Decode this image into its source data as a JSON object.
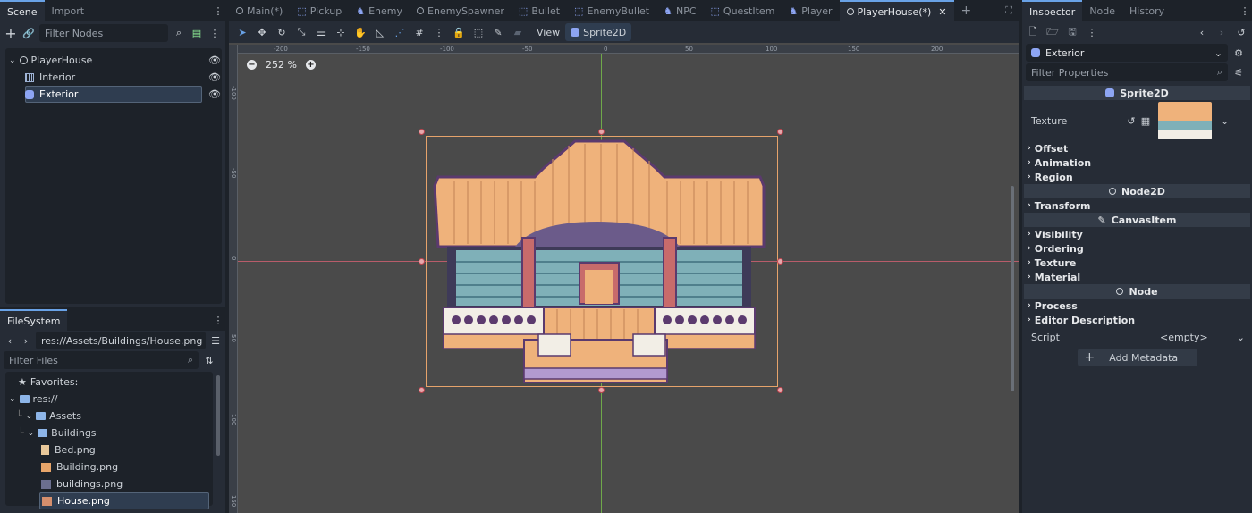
{
  "scene_panel": {
    "tabs": [
      "Scene",
      "Import"
    ],
    "filter_placeholder": "Filter Nodes",
    "nodes": [
      {
        "label": "PlayerHouse"
      },
      {
        "label": "Interior"
      },
      {
        "label": "Exterior"
      }
    ]
  },
  "filesystem": {
    "tab": "FileSystem",
    "path": "res://Assets/Buildings/House.png",
    "filter_placeholder": "Filter Files",
    "items": [
      {
        "label": "Favorites:"
      },
      {
        "label": "res://"
      },
      {
        "label": "Assets"
      },
      {
        "label": "Buildings"
      },
      {
        "label": "Bed.png"
      },
      {
        "label": "Building.png"
      },
      {
        "label": "buildings.png"
      },
      {
        "label": "House.png"
      }
    ]
  },
  "scene_tabs": [
    "Main(*)",
    "Pickup",
    "Enemy",
    "EnemySpawner",
    "Bullet",
    "EnemyBullet",
    "NPC",
    "QuestItem",
    "Player",
    "PlayerHouse(*)"
  ],
  "toolbar": {
    "view_label": "View",
    "sprite_label": "Sprite2D"
  },
  "viewport": {
    "zoom": "252 %",
    "ruler_h": [
      "-200",
      "-150",
      "-100",
      "-50",
      "0",
      "50",
      "100",
      "150",
      "200"
    ],
    "ruler_v": [
      "-100",
      "-50",
      "0",
      "50",
      "100",
      "150"
    ]
  },
  "inspector": {
    "tabs": [
      "Inspector",
      "Node",
      "History"
    ],
    "object": "Exterior",
    "filter_placeholder": "Filter Properties",
    "class_sprite": "Sprite2D",
    "texture_label": "Texture",
    "sprite_sections": [
      "Offset",
      "Animation",
      "Region"
    ],
    "class_node2d": "Node2D",
    "node2d_sections": [
      "Transform"
    ],
    "class_canvas": "CanvasItem",
    "canvas_sections": [
      "Visibility",
      "Ordering",
      "Texture",
      "Material"
    ],
    "class_node": "Node",
    "node_sections": [
      "Process",
      "Editor Description"
    ],
    "script_label": "Script",
    "script_value": "<empty>",
    "add_metadata": "Add Metadata"
  },
  "colors": {
    "accent": "#69a2e6",
    "bg": "#1d2229",
    "panel": "#262c36",
    "viewport": "#4a4a4a"
  }
}
